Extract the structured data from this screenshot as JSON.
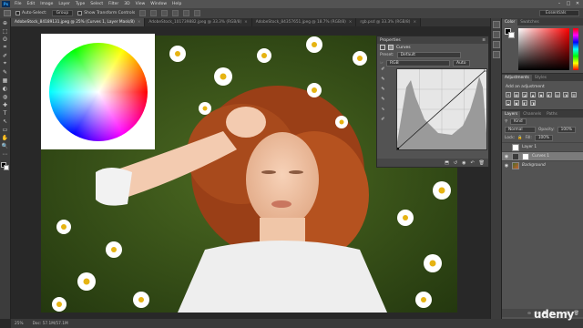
{
  "app": {
    "logo": "Ps"
  },
  "menu": [
    "File",
    "Edit",
    "Image",
    "Layer",
    "Type",
    "Select",
    "Filter",
    "3D",
    "View",
    "Window",
    "Help"
  ],
  "window_controls": [
    "–",
    "□",
    "✕"
  ],
  "options_bar": {
    "auto_select_label": "Auto-Select:",
    "auto_select_value": "Group",
    "show_transform_label": "Show Transform Controls",
    "workspace": "Essentials"
  },
  "tabs": [
    {
      "label": "AdobeStock_84189131.jpeg @ 25% (Curves 1, Layer Mask/8)",
      "active": true
    },
    {
      "label": "AdobeStock_101739882.jpeg @ 33.3% (RGB/8)",
      "active": false
    },
    {
      "label": "AdobeStock_84357651.jpeg @ 18.7% (RGB/8)",
      "active": false
    },
    {
      "label": "rgb.psd @ 33.3% (RGB/8)",
      "active": false
    }
  ],
  "tools": [
    "⊕",
    "⬚",
    "ʘ",
    "⌗",
    "✐",
    "⌖",
    "✎",
    "▦",
    "◐",
    "◍",
    "✚",
    "T",
    "↖",
    "▭",
    "✋",
    "🔍",
    "⋯"
  ],
  "properties": {
    "title": "Properties",
    "subtitle": "Curves",
    "preset_label": "Preset:",
    "preset_value": "Default",
    "channel_value": "RGB",
    "auto_label": "Auto",
    "side_tools": [
      "✐",
      "✎",
      "✎",
      "✎",
      "∿",
      "✐"
    ],
    "footer_icons": [
      "⬒",
      "↺",
      "◉",
      "↶",
      "🗑"
    ]
  },
  "color_panel": {
    "tabs": [
      "Color",
      "Swatches"
    ]
  },
  "adjustments_panel": {
    "tabs": [
      "Adjustments",
      "Styles"
    ],
    "add_label": "Add an adjustment",
    "icons": [
      "☀",
      "▦",
      "◪",
      "▲",
      "◆",
      "◐",
      "▤",
      "◑",
      "▥",
      "◒",
      "▣",
      "◧",
      "◨"
    ]
  },
  "layers_panel": {
    "tabs": [
      "Layers",
      "Channels",
      "Paths"
    ],
    "kind_label": "Kind",
    "blend_mode": "Normal",
    "opacity_label": "Opacity:",
    "opacity_value": "100%",
    "lock_label": "Lock:",
    "fill_label": "Fill:",
    "fill_value": "100%",
    "layers": [
      {
        "name": "Layer 1",
        "visible": false,
        "selected": false,
        "thumb": "white",
        "italic": false
      },
      {
        "name": "Curves 1",
        "visible": true,
        "selected": true,
        "thumb": "adj",
        "italic": false
      },
      {
        "name": "Background",
        "visible": true,
        "selected": false,
        "thumb": "photo",
        "italic": true
      }
    ],
    "footer_icons": [
      "∞",
      "fx",
      "◘",
      "◐",
      "▭",
      "▤",
      "🗑"
    ]
  },
  "status": {
    "zoom": "25%",
    "doc_info": "Doc: 57.1M/57.1M"
  },
  "watermark": "udemy"
}
